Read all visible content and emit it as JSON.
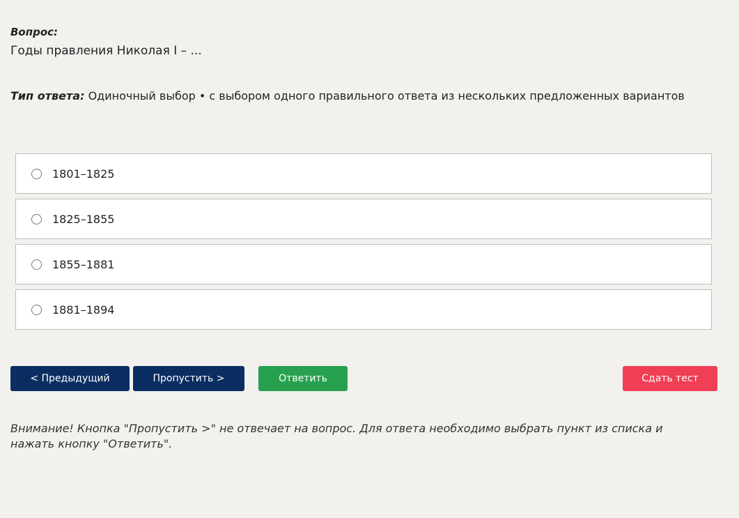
{
  "question": {
    "label": "Вопрос:",
    "text": "Годы правления Николая I – ..."
  },
  "answer_type": {
    "label": "Тип ответа:",
    "value": "Одиночный выбор • с выбором одного правильного ответа из нескольких предложенных вариантов"
  },
  "options": [
    {
      "label": "1801–1825",
      "selected": false
    },
    {
      "label": "1825–1855",
      "selected": false
    },
    {
      "label": "1855–1881",
      "selected": false
    },
    {
      "label": "1881–1894",
      "selected": false
    }
  ],
  "buttons": {
    "prev": "< Предыдущий",
    "skip": "Пропустить >",
    "answer": "Ответить",
    "submit": "Сдать тест"
  },
  "warning": "Внимание! Кнопка \"Пропустить >\" не отвечает на вопрос. Для ответа необходимо выбрать пункт из списка и нажать кнопку \"Ответить\".",
  "colors": {
    "background": "#f2f1ee",
    "nav_button": "#0b2e62",
    "answer_button": "#27a14f",
    "submit_button": "#f03f55"
  }
}
